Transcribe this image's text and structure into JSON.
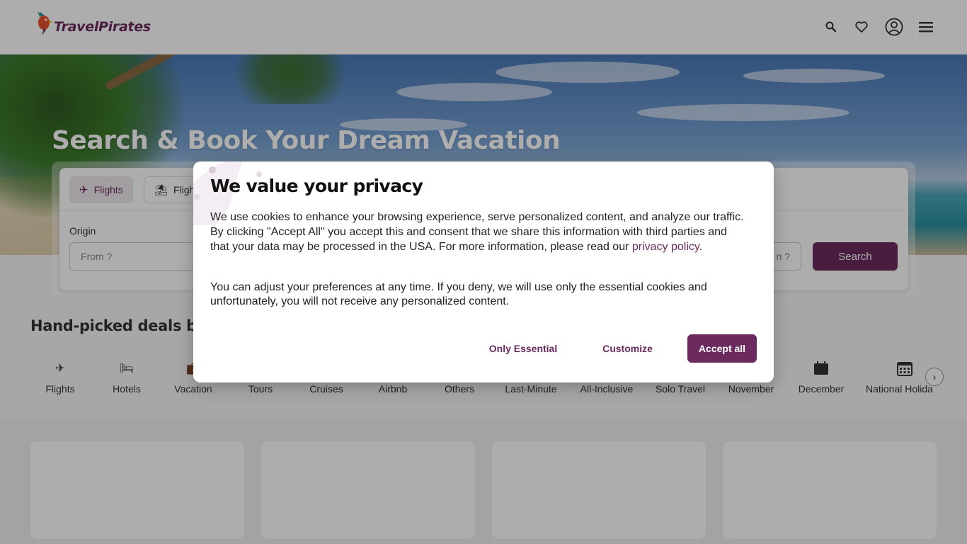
{
  "brand": {
    "name": "TravelPirates",
    "primary_color": "#6b2b5e"
  },
  "header": {
    "icons": [
      "search-icon",
      "heart-icon",
      "user-circle-icon",
      "menu-icon"
    ]
  },
  "hero": {
    "title": "Search & Book Your Dream Vacation"
  },
  "search": {
    "tabs": [
      {
        "label": "Flights",
        "icon": "plane-icon",
        "active": true
      },
      {
        "label": "Fligh",
        "icon": "flight-hotel-icon",
        "active": false
      }
    ],
    "origin_label": "Origin",
    "origin_placeholder": "From ?",
    "destination_placeholder": "n ?",
    "search_button": "Search"
  },
  "deals": {
    "title": "Hand-picked deals by ou",
    "categories": [
      {
        "label": "Flights",
        "icon": "plane-icon"
      },
      {
        "label": "Hotels",
        "icon": "bed-icon"
      },
      {
        "label": "Vacation",
        "icon": "suitcase-icon"
      },
      {
        "label": "Tours",
        "icon": "tour-icon"
      },
      {
        "label": "Cruises",
        "icon": "ship-icon"
      },
      {
        "label": "Airbnb",
        "icon": "airbnb-icon"
      },
      {
        "label": "Others",
        "icon": "others-icon"
      },
      {
        "label": "Last-Minute",
        "icon": "clock-icon"
      },
      {
        "label": "All-Inclusive",
        "icon": "cocktail-icon"
      },
      {
        "label": "Solo Travel",
        "icon": "person-icon"
      },
      {
        "label": "November",
        "icon": "calendar-icon"
      },
      {
        "label": "December",
        "icon": "calendar-icon"
      },
      {
        "label": "National Holida",
        "icon": "calendar-grid-icon"
      }
    ]
  },
  "cookie_modal": {
    "title": "We value your privacy",
    "paragraph1_before_link": "We use cookies to enhance your browsing experience, serve personalized content, and analyze our traffic. By clicking \"Accept All\" you accept this and consent that we share this information with third parties and that your data may be processed in the USA. For more information, please read our ",
    "privacy_link": "privacy policy",
    "paragraph1_after_link": ".",
    "paragraph2": "You can adjust your preferences at any time. If you deny, we will use only the essential cookies and unfortunately, you will not receive any personalized content.",
    "buttons": {
      "only_essential": "Only Essential",
      "customize": "Customize",
      "accept_all": "Accept all"
    }
  }
}
